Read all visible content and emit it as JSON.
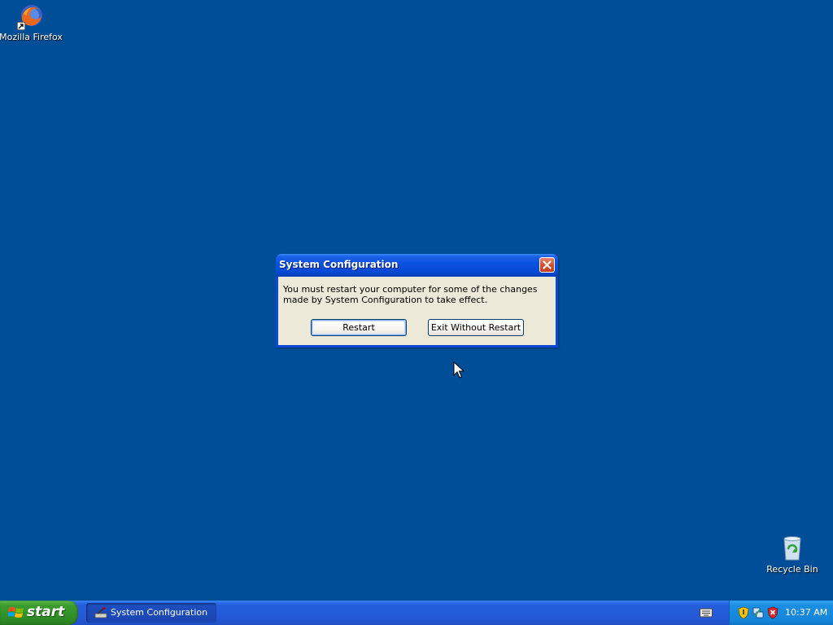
{
  "desktop": {
    "background_color": "#004e98",
    "icons": [
      {
        "label": "Mozilla Firefox",
        "icon": "firefox-icon"
      },
      {
        "label": "Recycle Bin",
        "icon": "recycle-bin-icon"
      }
    ]
  },
  "dialog": {
    "title": "System Configuration",
    "message": "You must restart your computer for some of the changes made by System Configuration to take effect.",
    "buttons": {
      "restart": "Restart",
      "exit_without_restart": "Exit Without Restart"
    },
    "close_icon": "close-icon"
  },
  "taskbar": {
    "start_label": "start",
    "tasks": [
      {
        "label": "System Configuration",
        "icon": "msconfig-icon"
      }
    ],
    "tray": {
      "icons": [
        "keyboard-icon",
        "security-shield-icon",
        "network-icon",
        "security-alert-icon"
      ],
      "clock": "10:37 AM"
    }
  },
  "colors": {
    "title_bar": "#0a52e0",
    "dialog_body": "#ece9d8",
    "start_button": "#3c9c2f",
    "taskbar": "#245edb",
    "tray": "#1585d9"
  }
}
